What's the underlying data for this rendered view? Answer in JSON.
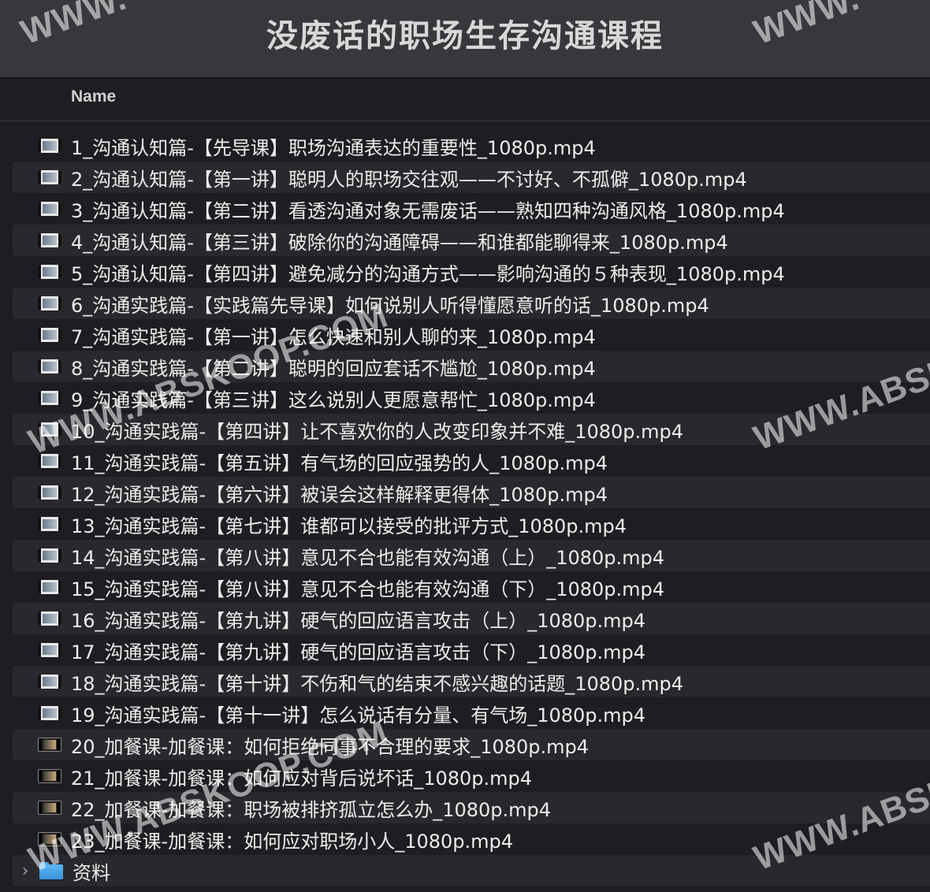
{
  "window": {
    "title": "没废话的职场生存沟通课程"
  },
  "columns": {
    "name": "Name"
  },
  "files": [
    {
      "name": "1_沟通认知篇-【先导课】职场沟通表达的重要性_1080p.mp4",
      "icon": "video-file-icon"
    },
    {
      "name": "2_沟通认知篇-【第一讲】聪明人的职场交往观——不讨好、不孤僻_1080p.mp4",
      "icon": "video-file-icon"
    },
    {
      "name": "3_沟通认知篇-【第二讲】看透沟通对象无需废话——熟知四种沟通风格_1080p.mp4",
      "icon": "video-file-icon"
    },
    {
      "name": "4_沟通认知篇-【第三讲】破除你的沟通障碍——和谁都能聊得来_1080p.mp4",
      "icon": "video-file-icon"
    },
    {
      "name": "5_沟通认知篇-【第四讲】避免减分的沟通方式——影响沟通的５种表现_1080p.mp4",
      "icon": "video-file-icon"
    },
    {
      "name": "6_沟通实践篇-【实践篇先导课】如何说别人听得懂愿意听的话_1080p.mp4",
      "icon": "video-file-icon"
    },
    {
      "name": "7_沟通实践篇-【第一讲】怎么快速和别人聊的来_1080p.mp4",
      "icon": "video-file-icon"
    },
    {
      "name": "8_沟通实践篇-【第二讲】聪明的回应套话不尴尬_1080p.mp4",
      "icon": "video-file-icon"
    },
    {
      "name": "9_沟通实践篇-【第三讲】这么说别人更愿意帮忙_1080p.mp4",
      "icon": "video-file-icon"
    },
    {
      "name": "10_沟通实践篇-【第四讲】让不喜欢你的人改变印象并不难_1080p.mp4",
      "icon": "video-file-icon"
    },
    {
      "name": "11_沟通实践篇-【第五讲】有气场的回应强势的人_1080p.mp4",
      "icon": "video-file-icon"
    },
    {
      "name": "12_沟通实践篇-【第六讲】被误会这样解释更得体_1080p.mp4",
      "icon": "video-file-icon"
    },
    {
      "name": "13_沟通实践篇-【第七讲】谁都可以接受的批评方式_1080p.mp4",
      "icon": "video-file-icon"
    },
    {
      "name": "14_沟通实践篇-【第八讲】意见不合也能有效沟通（上）_1080p.mp4",
      "icon": "video-file-icon"
    },
    {
      "name": "15_沟通实践篇-【第八讲】意见不合也能有效沟通（下）_1080p.mp4",
      "icon": "video-file-icon"
    },
    {
      "name": "16_沟通实践篇-【第九讲】硬气的回应语言攻击（上）_1080p.mp4",
      "icon": "video-file-icon"
    },
    {
      "name": "17_沟通实践篇-【第九讲】硬气的回应语言攻击（下）_1080p.mp4",
      "icon": "video-file-icon"
    },
    {
      "name": "18_沟通实践篇-【第十讲】不伤和气的结束不感兴趣的话题_1080p.mp4",
      "icon": "video-file-icon"
    },
    {
      "name": "19_沟通实践篇-【第十一讲】怎么说话有分量、有气场_1080p.mp4",
      "icon": "video-file-icon"
    },
    {
      "name": "20_加餐课-加餐课：如何拒绝同事不合理的要求_1080p.mp4",
      "icon": "video-file-icon"
    },
    {
      "name": "21_加餐课-加餐课：如何应对背后说坏话_1080p.mp4",
      "icon": "video-file-icon"
    },
    {
      "name": "22_加餐课-加餐课：职场被排挤孤立怎么办_1080p.mp4",
      "icon": "video-file-icon"
    },
    {
      "name": "23_加餐课-加餐课：如何应对职场小人_1080p.mp4",
      "icon": "video-file-icon"
    }
  ],
  "folder": {
    "name": "资料",
    "icon": "folder-icon",
    "disclosure": "›"
  },
  "watermarks": {
    "a": "WWW.ABSKOOP.COM",
    "b": "WWW.ABSK",
    "c": "WWW.ABSKOOP.COM",
    "d": "WWW.ABSK",
    "e": "WWW.",
    "f": "WWW."
  },
  "colors": {
    "titlebar": "#38383c",
    "background": "#1e1e22",
    "alt_row": "#29292d",
    "folder": "#4aa3e8"
  }
}
